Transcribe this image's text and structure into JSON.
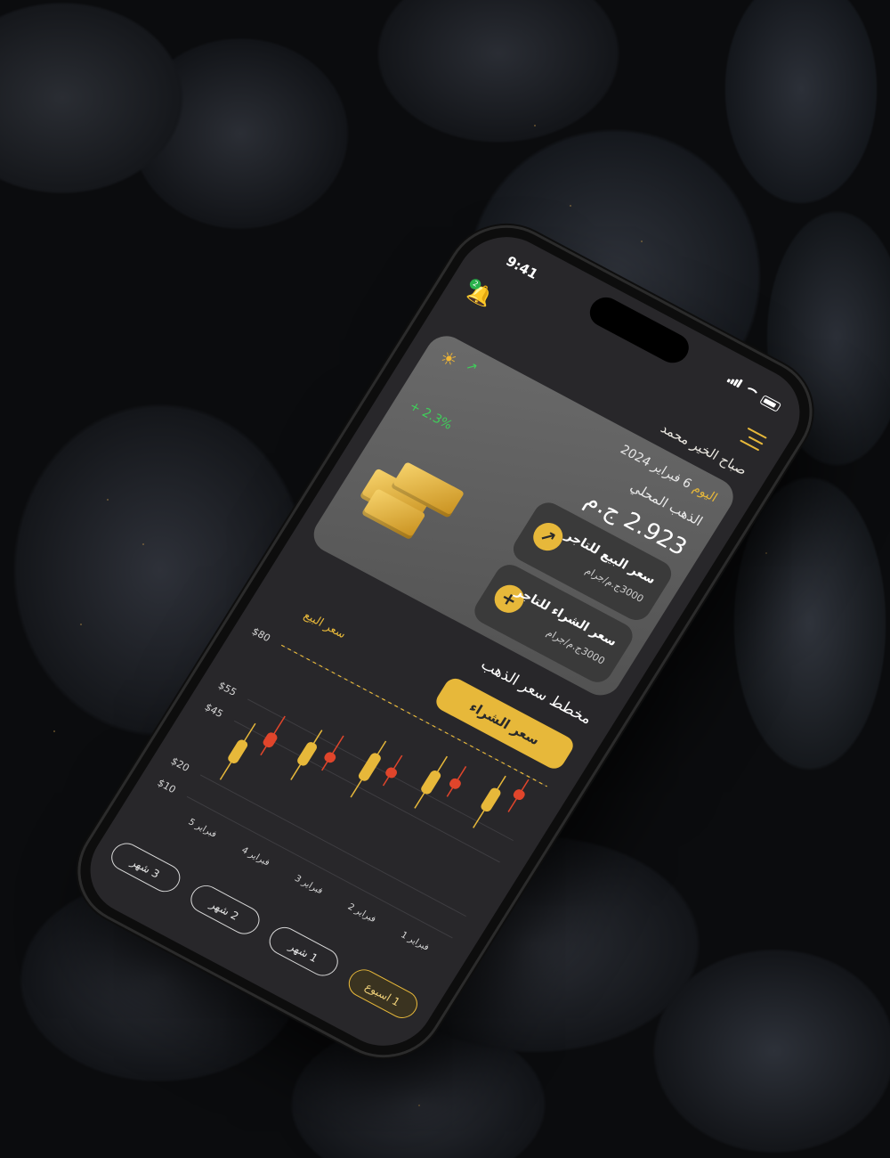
{
  "status_bar": {
    "time": "9:41"
  },
  "header": {
    "greeting": "صباح الخير محمد",
    "notification_count": "2"
  },
  "hero": {
    "today_label": "اليوم",
    "date": "6 فبراير 2024",
    "local_gold_label": "الذهب المحلي",
    "price": "2.923 ج.م",
    "change": "+ 2.3%",
    "sell_tile": {
      "title": "سعر البيع للتاجر",
      "subtitle": "3000ج.م/جرام"
    },
    "buy_tile": {
      "title": "سعر الشراء للتاجر",
      "subtitle": "3000ج.م/جرام"
    }
  },
  "chart_section": {
    "title": "مخطط سعر الذهب",
    "legend_buy": "سعر الشراء",
    "legend_sell": "سعر البيع"
  },
  "colors": {
    "accent": "#e7b83a",
    "down": "#e0452b",
    "up": "#3fcf5a"
  },
  "chart_data": {
    "type": "candlestick",
    "categories": [
      "5 فبراير",
      "4 فبراير",
      "3 فبراير",
      "2 فبراير",
      "1 فبراير"
    ],
    "y_ticks": [
      "$10",
      "$20",
      "$45",
      "$55",
      "$80"
    ],
    "ylim": [
      10,
      80
    ],
    "series": [
      {
        "name": "سعر الشراء",
        "candles": [
          {
            "o": 30,
            "h": 48,
            "l": 22,
            "c": 40,
            "dir": "up"
          },
          {
            "o": 42,
            "h": 58,
            "l": 35,
            "c": 52,
            "dir": "up"
          },
          {
            "o": 48,
            "h": 66,
            "l": 40,
            "c": 60,
            "dir": "up"
          },
          {
            "o": 55,
            "h": 72,
            "l": 48,
            "c": 65,
            "dir": "up"
          },
          {
            "o": 60,
            "h": 76,
            "l": 52,
            "c": 70,
            "dir": "up"
          }
        ]
      },
      {
        "name": "سعر البيع",
        "candles": [
          {
            "o": 48,
            "h": 56,
            "l": 38,
            "c": 42,
            "dir": "down"
          },
          {
            "o": 52,
            "h": 60,
            "l": 44,
            "c": 48,
            "dir": "down"
          },
          {
            "o": 58,
            "h": 64,
            "l": 50,
            "c": 54,
            "dir": "down"
          },
          {
            "o": 66,
            "h": 72,
            "l": 58,
            "c": 62,
            "dir": "down"
          },
          {
            "o": 74,
            "h": 79,
            "l": 64,
            "c": 70,
            "dir": "down"
          }
        ]
      }
    ],
    "grid": true
  },
  "ranges": [
    "3 شهر",
    "2 شهر",
    "1 شهر",
    "1 اسبوع"
  ],
  "active_range": "1 اسبوع"
}
